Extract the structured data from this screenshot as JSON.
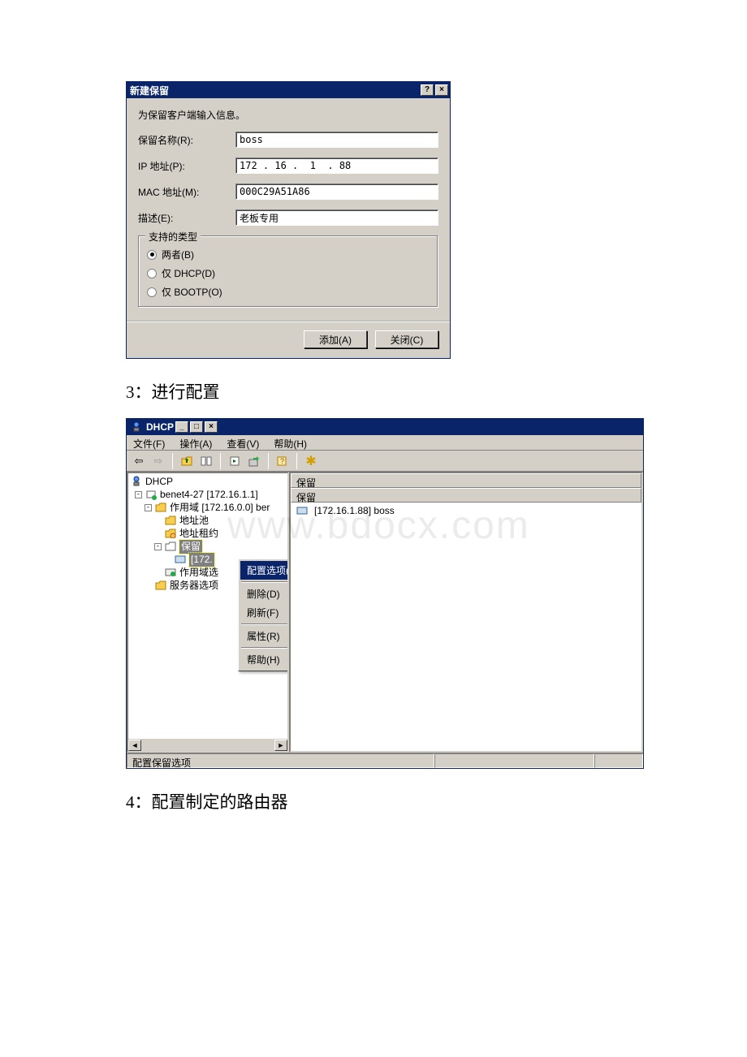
{
  "dialog1": {
    "title": "新建保留",
    "help_btn": "?",
    "close_btn": "×",
    "intro": "为保留客户端输入信息。",
    "labels": {
      "name": "保留名称(R):",
      "ip": "IP 地址(P):",
      "mac": "MAC 地址(M):",
      "desc": "描述(E):"
    },
    "values": {
      "name": "boss",
      "ip": "172 . 16 .  1  . 88",
      "mac": "000C29A51A86",
      "desc": "老板专用"
    },
    "group_title": "支持的类型",
    "radios": {
      "both": "两者(B)",
      "dhcp": "仅 DHCP(D)",
      "bootp": "仅 BOOTP(O)"
    },
    "buttons": {
      "add": "添加(A)",
      "close": "关闭(C)"
    }
  },
  "caption1": "3：进行配置",
  "window2": {
    "title": "DHCP",
    "min_btn": "_",
    "max_btn": "□",
    "close_btn": "×",
    "menu": {
      "file": "文件(F)",
      "action": "操作(A)",
      "view": "查看(V)",
      "help": "帮助(H)"
    },
    "tree": {
      "root": "DHCP",
      "server": "benet4-27 [172.16.1.1]",
      "scope": "作用域 [172.16.0.0] ber",
      "pool": "地址池",
      "lease": "地址租约",
      "reservation": "保留",
      "res_item": "[172.",
      "scope_opt": "作用域选",
      "server_opt": "服务器选项"
    },
    "ctx": {
      "config": "配置选项(C)...",
      "delete": "删除(D)",
      "refresh": "刷新(F)",
      "prop": "属性(R)",
      "help": "帮助(H)"
    },
    "list": {
      "col1": "保留",
      "col2": "保留",
      "row1": "[172.16.1.88] boss"
    },
    "status": "配置保留选项"
  },
  "caption2": "4：配置制定的路由器"
}
